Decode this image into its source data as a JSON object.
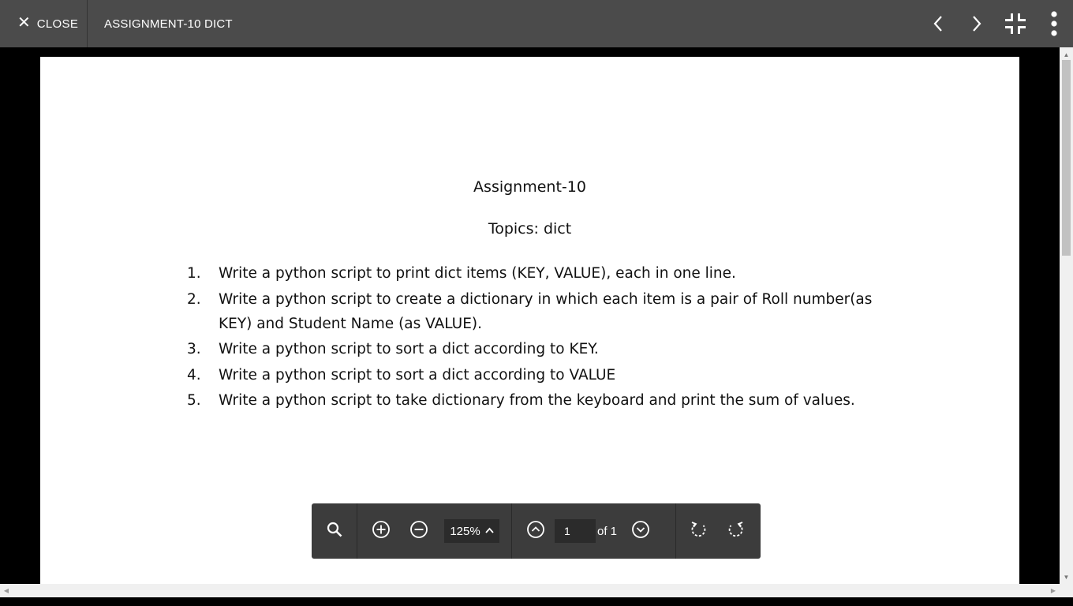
{
  "header": {
    "close_label": "CLOSE",
    "title": "ASSIGNMENT-10 DICT",
    "icons": [
      "chevron-left-icon",
      "chevron-right-icon",
      "exit-fullscreen-icon",
      "more-vert-icon"
    ]
  },
  "document": {
    "title": "Assignment-10",
    "subtitle": "Topics: dict",
    "questions": [
      {
        "num": "1.",
        "text": "Write a python script to print dict items (KEY, VALUE), each in one line."
      },
      {
        "num": "2.",
        "text": "Write a python script to create a dictionary in which each item is a pair of Roll number(as KEY) and Student Name (as VALUE)."
      },
      {
        "num": "3.",
        "text": "Write a python script to sort a dict according to KEY."
      },
      {
        "num": "4.",
        "text": "Write a python script to sort a dict according to VALUE"
      },
      {
        "num": "5.",
        "text": "Write a python script to take dictionary from the keyboard and print the sum of values."
      }
    ]
  },
  "toolbar": {
    "zoom": "125%",
    "page_value": "1",
    "page_total_label": "of 1",
    "icons": [
      "search-icon",
      "zoom-in-icon",
      "zoom-out-icon",
      "page-up-icon",
      "page-down-icon",
      "rotate-left-icon",
      "rotate-right-icon"
    ]
  },
  "colors": {
    "topbar": "#4b4b4b",
    "toolbar": "#3c3c3c",
    "background": "#000000",
    "page": "#ffffff"
  }
}
